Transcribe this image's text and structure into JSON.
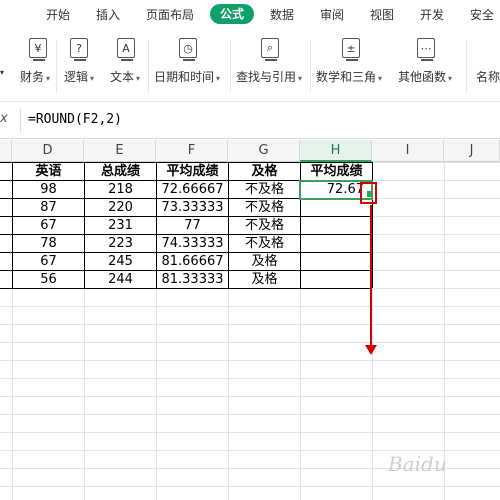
{
  "tabs": [
    "开始",
    "插入",
    "页面布局",
    "公式",
    "数据",
    "审阅",
    "视图",
    "开发",
    "安全"
  ],
  "active_tab": "公式",
  "ribbon": {
    "groups": [
      {
        "label": "财务",
        "icon": "finance-icon",
        "glyph": "¥"
      },
      {
        "label": "逻辑",
        "icon": "logic-icon",
        "glyph": "?"
      },
      {
        "label": "文本",
        "icon": "text-icon",
        "glyph": "A"
      },
      {
        "label": "日期和时间",
        "icon": "clock-icon",
        "glyph": "◷"
      },
      {
        "label": "查找与引用",
        "icon": "lookup-icon",
        "glyph": "⌕"
      },
      {
        "label": "数学和三角",
        "icon": "math-icon",
        "glyph": "±"
      },
      {
        "label": "其他函数",
        "icon": "more-icon",
        "glyph": "⋯"
      },
      {
        "label": "名称",
        "icon": "name-icon",
        "glyph": ""
      }
    ]
  },
  "formula_bar": {
    "fx_label": "x",
    "formula": "=ROUND(F2,2)"
  },
  "columns": [
    "D",
    "E",
    "F",
    "G",
    "H",
    "I",
    "J"
  ],
  "selected_column": "H",
  "table": {
    "headers": [
      "英语",
      "总成绩",
      "平均成绩",
      "及格",
      "平均成绩"
    ],
    "rows": [
      [
        "98",
        "218",
        "72.66667",
        "不及格",
        "72.67"
      ],
      [
        "87",
        "220",
        "73.33333",
        "不及格",
        ""
      ],
      [
        "67",
        "231",
        "77",
        "不及格",
        ""
      ],
      [
        "78",
        "223",
        "74.33333",
        "不及格",
        ""
      ],
      [
        "67",
        "245",
        "81.66667",
        "及格",
        ""
      ],
      [
        "56",
        "244",
        "81.33333",
        "及格",
        ""
      ]
    ]
  },
  "watermark": "Baidu",
  "colors": {
    "accent": "#0fa06a",
    "selection": "#3aa05a",
    "annotation": "#d40000"
  }
}
